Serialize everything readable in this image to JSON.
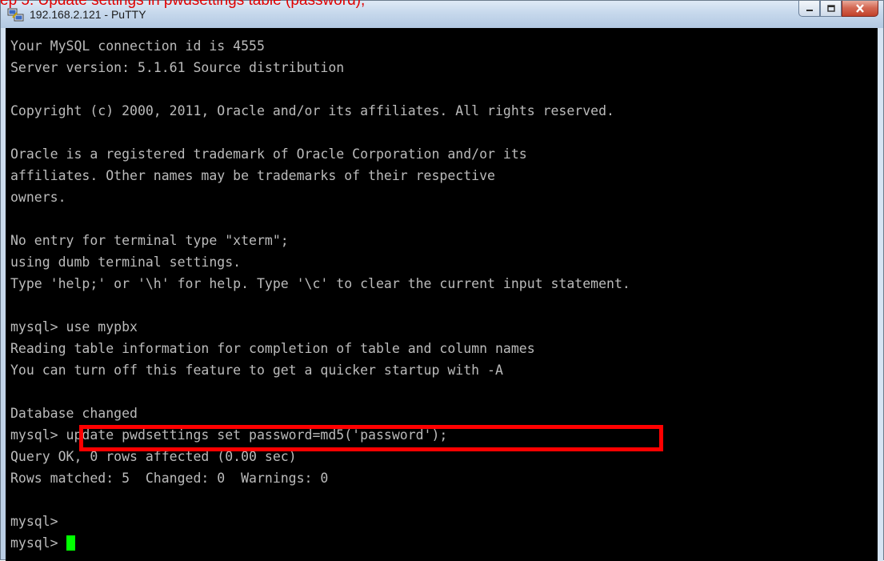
{
  "window": {
    "title": "192.168.2.121 - PuTTY",
    "controls": [
      {
        "name": "minimize-button",
        "icon": "minimize-icon"
      },
      {
        "name": "maximize-button",
        "icon": "maximize-icon"
      },
      {
        "name": "close-button",
        "icon": "close-icon"
      }
    ]
  },
  "caption": "ep 5: Update settings in pwdsettings table (password),",
  "terminal": {
    "lines": [
      "Your MySQL connection id is 4555",
      "Server version: 5.1.61 Source distribution",
      "",
      "Copyright (c) 2000, 2011, Oracle and/or its affiliates. All rights reserved.",
      "",
      "Oracle is a registered trademark of Oracle Corporation and/or its",
      "affiliates. Other names may be trademarks of their respective",
      "owners.",
      "",
      "No entry for terminal type \"xterm\";",
      "using dumb terminal settings.",
      "Type 'help;' or '\\h' for help. Type '\\c' to clear the current input statement.",
      "",
      "mysql> use mypbx",
      "Reading table information for completion of table and column names",
      "You can turn off this feature to get a quicker startup with -A",
      "",
      "Database changed",
      "mysql> update pwdsettings set password=md5('password');",
      "Query OK, 0 rows affected (0.00 sec)",
      "Rows matched: 5  Changed: 0  Warnings: 0",
      "",
      "mysql>",
      "mysql> "
    ],
    "cursor_color": "#00ff00",
    "text_color": "#bbbbbb",
    "highlight_color": "#ff0000"
  }
}
